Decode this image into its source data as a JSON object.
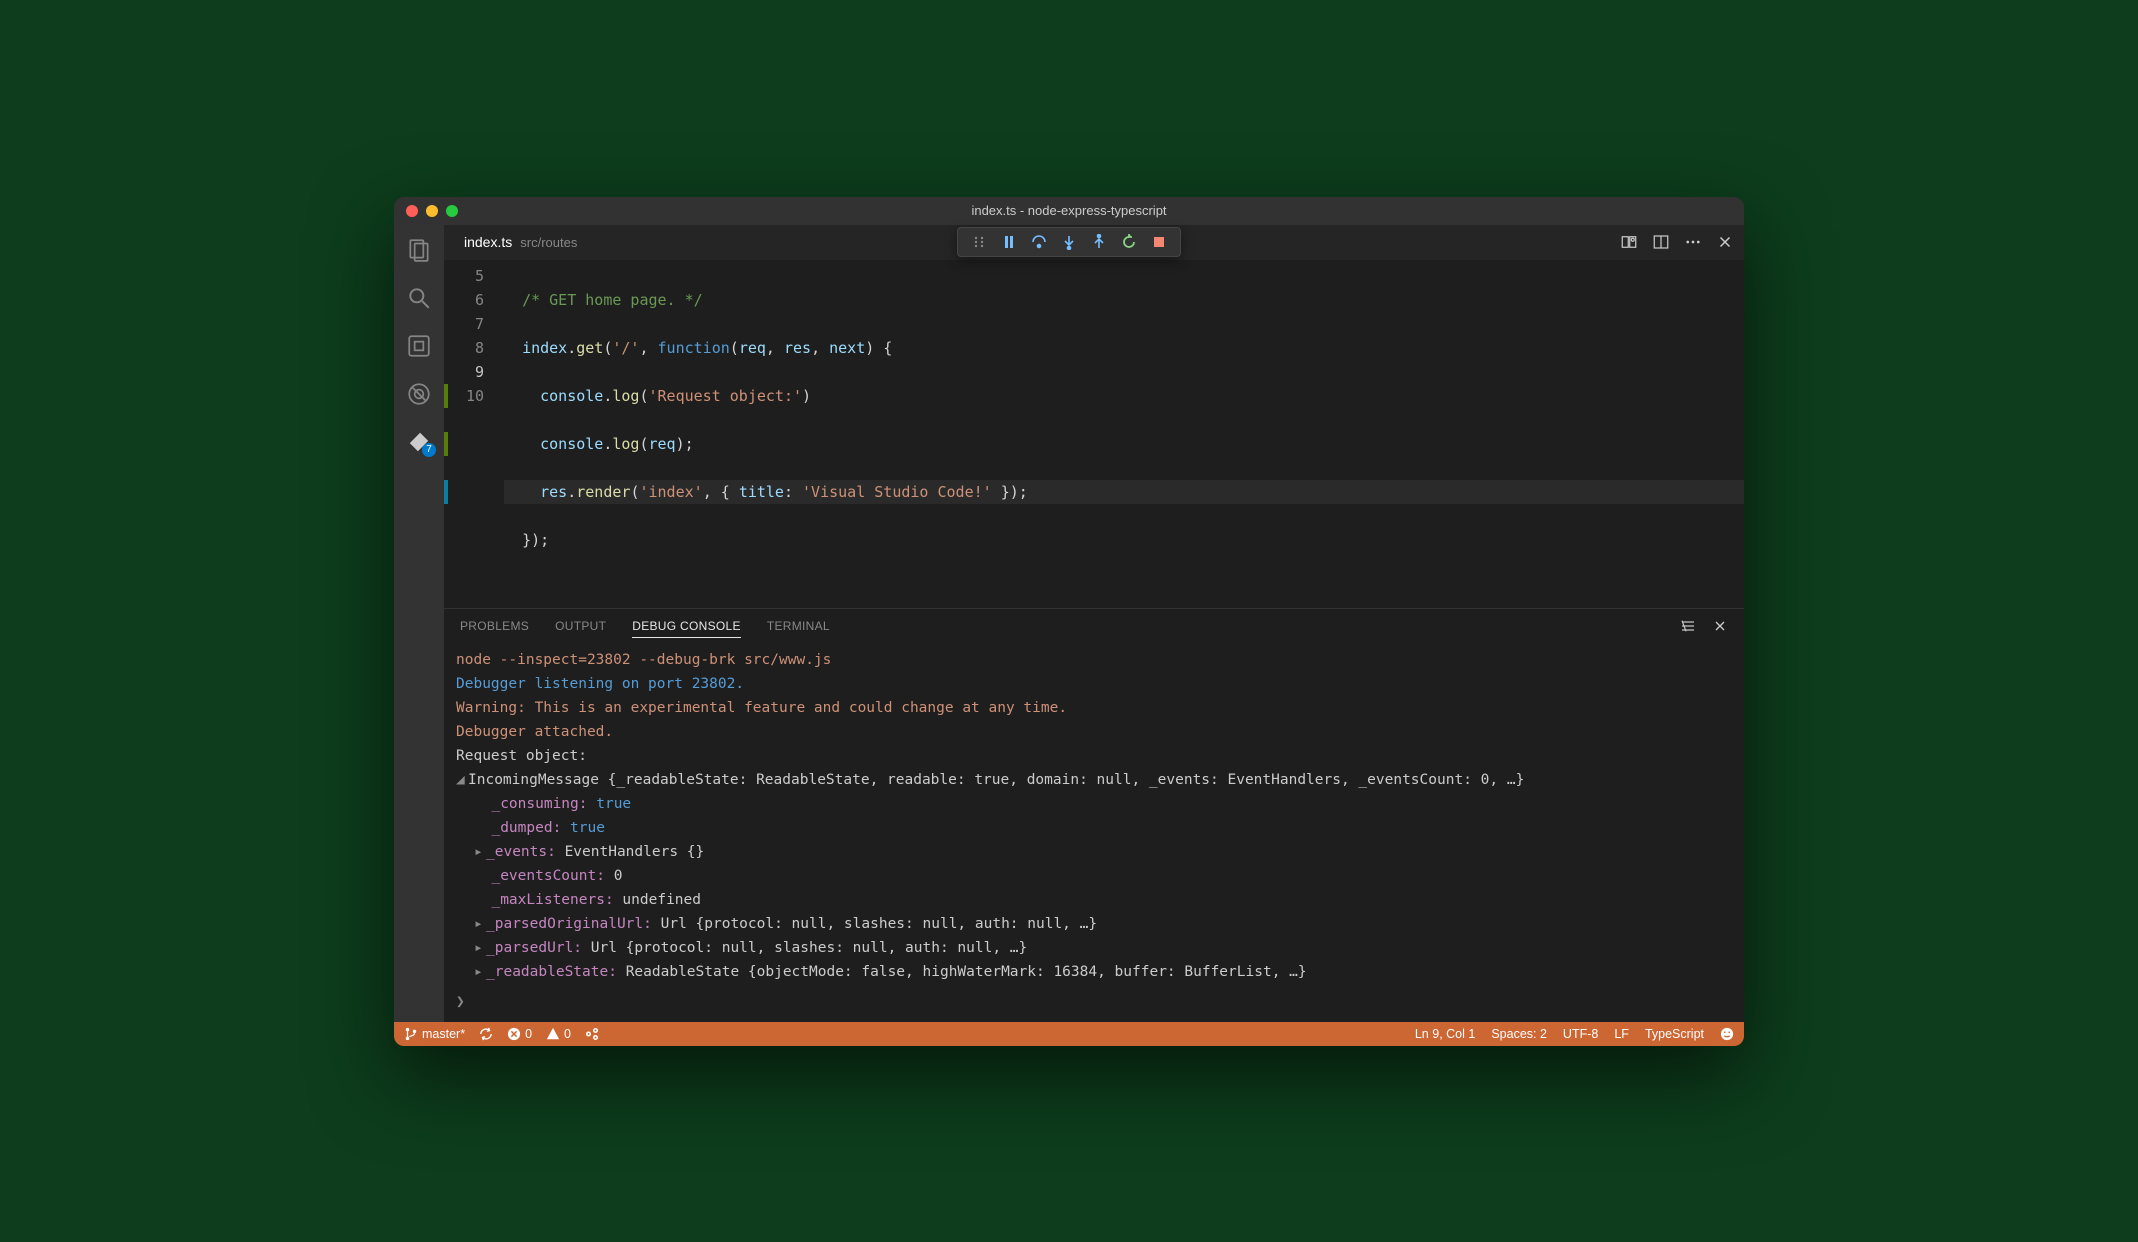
{
  "window_title": "index.ts - node-express-typescript",
  "tab": {
    "name": "index.ts",
    "path": "src/routes"
  },
  "activity_badge": "7",
  "code": {
    "lines": [
      "5",
      "6",
      "7",
      "8",
      "9",
      "10"
    ],
    "l5": "/* GET home page. */",
    "l6a": "index",
    "l6b": "get",
    "l6c": "'/'",
    "l6d": "function",
    "l6e": "req",
    "l6f": "res",
    "l6g": "next",
    "l7a": "console",
    "l7b": "log",
    "l7c": "'Request object:'",
    "l8a": "console",
    "l8b": "log",
    "l8c": "req",
    "l9a": "res",
    "l9b": "render",
    "l9c": "'index'",
    "l9d": "title",
    "l9e": "'Visual Studio Code!'",
    "l10": "});"
  },
  "panel": {
    "tabs": {
      "problems": "PROBLEMS",
      "output": "OUTPUT",
      "debug": "DEBUG CONSOLE",
      "terminal": "TERMINAL"
    }
  },
  "console": {
    "cmd": "node --inspect=23802 --debug-brk src/www.js",
    "listening": "Debugger listening on port 23802.",
    "warning": "Warning: This is an experimental feature and could change at any time.",
    "attached": "Debugger attached.",
    "reqobj": "Request object:",
    "incoming": "IncomingMessage {_readableState: ReadableState, readable: true, domain: null, _events: EventHandlers, _eventsCount: 0, …}",
    "p1k": "_consuming:",
    "p1v": "true",
    "p2k": "_dumped:",
    "p2v": "true",
    "p3k": "_events:",
    "p3v": "EventHandlers {}",
    "p4k": "_eventsCount:",
    "p4v": "0",
    "p5k": "_maxListeners:",
    "p5v": "undefined",
    "p6k": "_parsedOriginalUrl:",
    "p6v": "Url {protocol: null, slashes: null, auth: null, …}",
    "p7k": "_parsedUrl:",
    "p7v": "Url {protocol: null, slashes: null, auth: null, …}",
    "p8k": "_readableState:",
    "p8v": "ReadableState {objectMode: false, highWaterMark: 16384, buffer: BufferList, …}"
  },
  "status": {
    "branch": "master*",
    "errors": "0",
    "warnings": "0",
    "position": "Ln 9, Col 1",
    "spaces": "Spaces: 2",
    "encoding": "UTF-8",
    "eol": "LF",
    "lang": "TypeScript"
  }
}
